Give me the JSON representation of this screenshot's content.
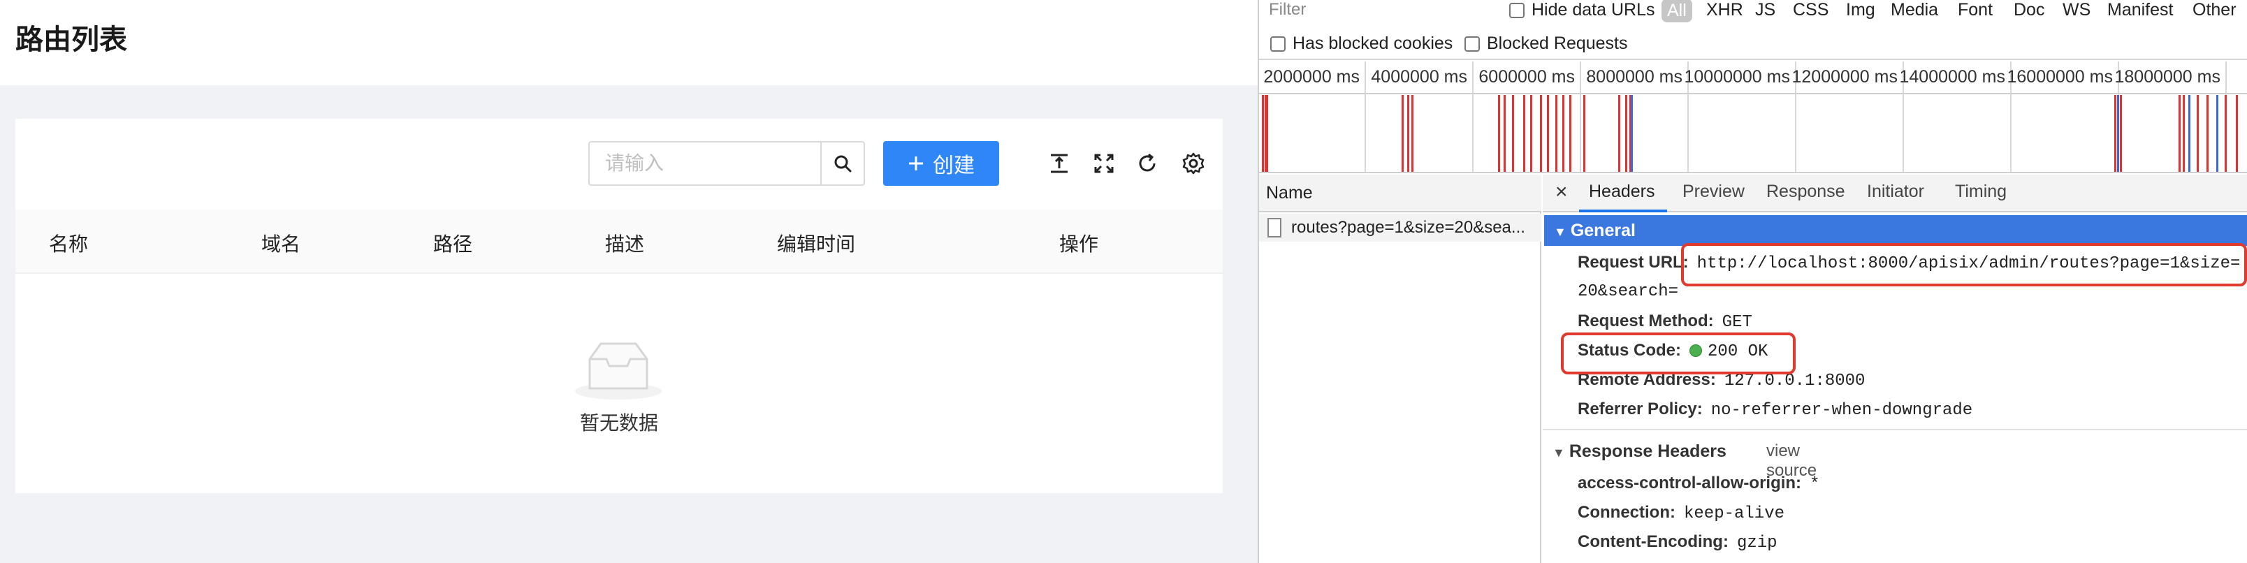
{
  "app": {
    "title": "路由列表",
    "search": {
      "placeholder": "请输入"
    },
    "create_label": "创建",
    "columns": [
      "名称",
      "域名",
      "路径",
      "描述",
      "编辑时间",
      "操作"
    ],
    "empty_text": "暂无数据"
  },
  "devtools": {
    "filter": {
      "placeholder": "Filter"
    },
    "checkboxes": {
      "hide_data_urls": "Hide data URLs",
      "has_blocked_cookies": "Has blocked cookies",
      "blocked_requests": "Blocked Requests"
    },
    "types": [
      "All",
      "XHR",
      "JS",
      "CSS",
      "Img",
      "Media",
      "Font",
      "Doc",
      "WS",
      "Manifest",
      "Other"
    ],
    "timeline_ticks": [
      "2000000 ms",
      "4000000 ms",
      "6000000 ms",
      "8000000 ms",
      "10000000 ms",
      "12000000 ms",
      "14000000 ms",
      "16000000 ms",
      "18000000 ms"
    ],
    "name_header": "Name",
    "request_name": "routes?page=1&size=20&sea...",
    "detail_tabs": [
      "Headers",
      "Preview",
      "Response",
      "Initiator",
      "Timing"
    ],
    "general": {
      "title": "General",
      "request_url_label": "Request URL:",
      "request_url_line1": "http://localhost:8000/apisix/admin/routes?page=1&size=",
      "request_url_line2": "20&search=",
      "request_method_label": "Request Method:",
      "request_method": "GET",
      "status_code_label": "Status Code:",
      "status_code": "200 OK",
      "remote_address_label": "Remote Address:",
      "remote_address": "127.0.0.1:8000",
      "referrer_policy_label": "Referrer Policy:",
      "referrer_policy": "no-referrer-when-downgrade"
    },
    "response_headers": {
      "title": "Response Headers",
      "view_source": "view source",
      "acao_label": "access-control-allow-origin:",
      "acao": "*",
      "connection_label": "Connection:",
      "connection": "keep-alive",
      "content_encoding_label": "Content-Encoding:",
      "content_encoding": "gzip"
    }
  }
}
